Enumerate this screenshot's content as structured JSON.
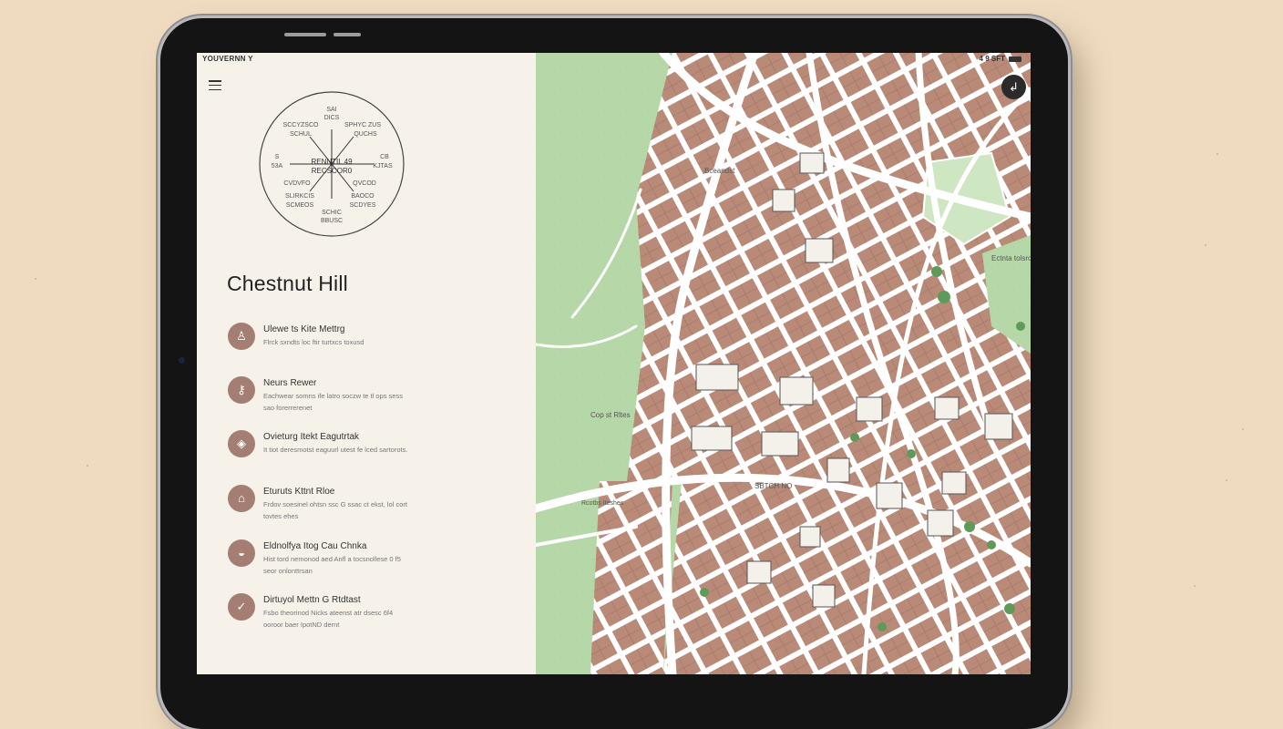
{
  "status": {
    "left": "YOUVERNN Y",
    "right": "4 9 SFT"
  },
  "compass": {
    "center_line1": "RENNTIL 49",
    "center_line2": "RECSCOR0",
    "labels": [
      "SAI",
      "DICS",
      "SCCYZSCO",
      "SCHUL",
      "SPHYC ZUS",
      "QUCHS",
      "S",
      "53A",
      "CB",
      "KJTAS",
      "CVDVFO",
      "SLIRKCIS",
      "SCMEOS",
      "QVCOD",
      "BAOCO",
      "SCDYES",
      "SCHIC",
      "BBUSC"
    ]
  },
  "neighborhood": {
    "title": "Chestnut Hill"
  },
  "features": [
    {
      "icon": "walking-icon",
      "glyph": "♙",
      "title": "Ulewe ts Kite Mettrg",
      "desc": "Flrck sxndts loc ftir turtxcs toxusd"
    },
    {
      "icon": "key-icon",
      "glyph": "⚷",
      "title": "Neurs Rewer",
      "desc": "Eachwear somns ife latro soczw te tl ops sess sao forerrerenet"
    },
    {
      "icon": "shield-icon",
      "glyph": "◈",
      "title": "Ovieturg Itekt Eagutrtak",
      "desc": "It tiot deresmotst eaguurl utest fe lced sartorots."
    },
    {
      "icon": "house-icon",
      "glyph": "⌂",
      "title": "Eturuts Kttnt Rloe",
      "desc": "Frdov soesinel ohtsn ssc G ssac ct ekst, lol cort tovtes ehes"
    },
    {
      "icon": "dome-icon",
      "glyph": "◒",
      "title": "Eldnolfya Itog Cau Chnka",
      "desc": "Hist tord nemonod aed Anfl a tocsnollese 0 f5 seor onlonttrsan"
    },
    {
      "icon": "check-icon",
      "glyph": "✓",
      "title": "Dirtuyol Mettn G Rtdtast",
      "desc": "Fsbo theorinod Nicks ateenst atr dsesc 6f4 ooroor baer IpotND dernt"
    }
  ],
  "map": {
    "labels": {
      "park_top": "Bceandst",
      "park_center": "Cop st Rltes",
      "right_district": "Ectnta tolsrout",
      "street_center": "SBTCH NO",
      "street_left": "Rcotbs Iteshes"
    }
  },
  "fab": {
    "icon": "compass-arrow-icon",
    "glyph": "↲"
  },
  "colors": {
    "background": "#efdcc0",
    "panel": "#f6f2ea",
    "accent": "#a57e73",
    "map_green": "#b6d8a8",
    "map_block": "#b98a77",
    "street": "#ffffff"
  }
}
